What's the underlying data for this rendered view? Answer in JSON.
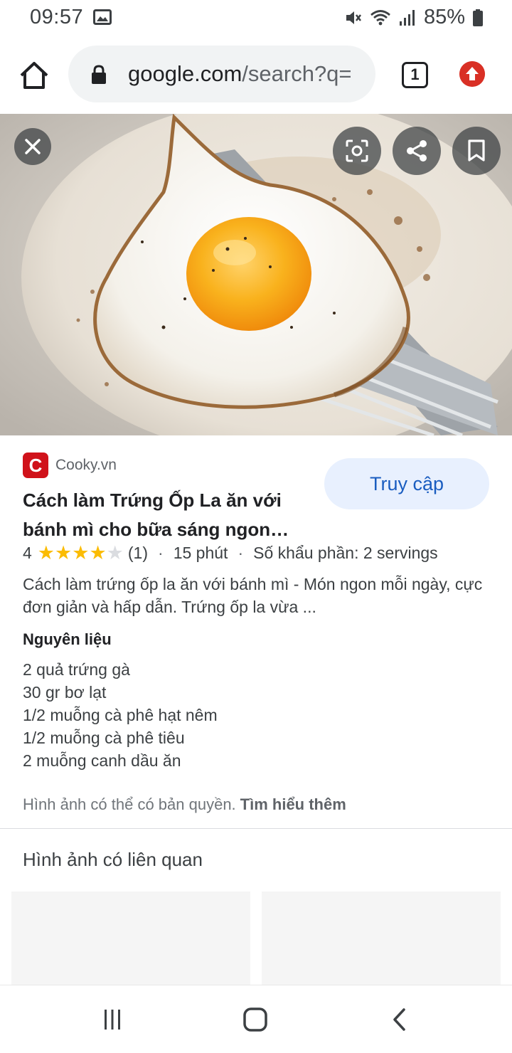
{
  "status_bar": {
    "time": "09:57",
    "battery": "85%",
    "icons": [
      "image-icon",
      "mute-icon",
      "wifi-icon",
      "signal-icon",
      "battery-icon"
    ]
  },
  "browser": {
    "url_host": "google.com",
    "url_rest": "/search?q=",
    "tab_count": "1",
    "icons": [
      "home-icon",
      "lock-icon",
      "update-icon"
    ]
  },
  "viewer": {
    "image_subject": "fried egg on spatula",
    "buttons": [
      "close-icon",
      "lens-icon",
      "share-icon",
      "bookmark-icon"
    ]
  },
  "result": {
    "favicon_letter": "C",
    "source": "Cooky.vn",
    "visit_label": "Truy cập",
    "title": "Cách làm Trứng Ốp La ăn với bánh mì cho bữa sáng ngon…",
    "rating_value": "4",
    "rating_stars": 4,
    "rating_count": "(1)",
    "time": "15 phút",
    "servings": "Số khẩu phần: 2 servings",
    "description": "Cách làm trứng ốp la ăn với bánh mì - Món ngon mỗi ngày, cực đơn giản và hấp dẫn. Trứng ốp la vừa ...",
    "ingredients_heading": "Nguyên liệu",
    "ingredients": [
      "2 quả trứng gà",
      "30 gr bơ lạt",
      "1/2 muỗng cà phê hạt nêm",
      "1/2 muỗng cà phê tiêu",
      "2 muỗng canh dầu ăn"
    ],
    "copyright_text": "Hình ảnh có thể có bản quyền.",
    "learn_more": "Tìm hiểu thêm"
  },
  "related": {
    "heading": "Hình ảnh có liên quan"
  },
  "colors": {
    "accent": "#1a5dc0",
    "visit_bg": "#e8f0fe",
    "star": "#fbbc04",
    "favicon": "#d0121a",
    "update": "#d93025"
  },
  "nav": {
    "icons": [
      "recent-apps-icon",
      "home-nav-icon",
      "back-icon"
    ]
  }
}
